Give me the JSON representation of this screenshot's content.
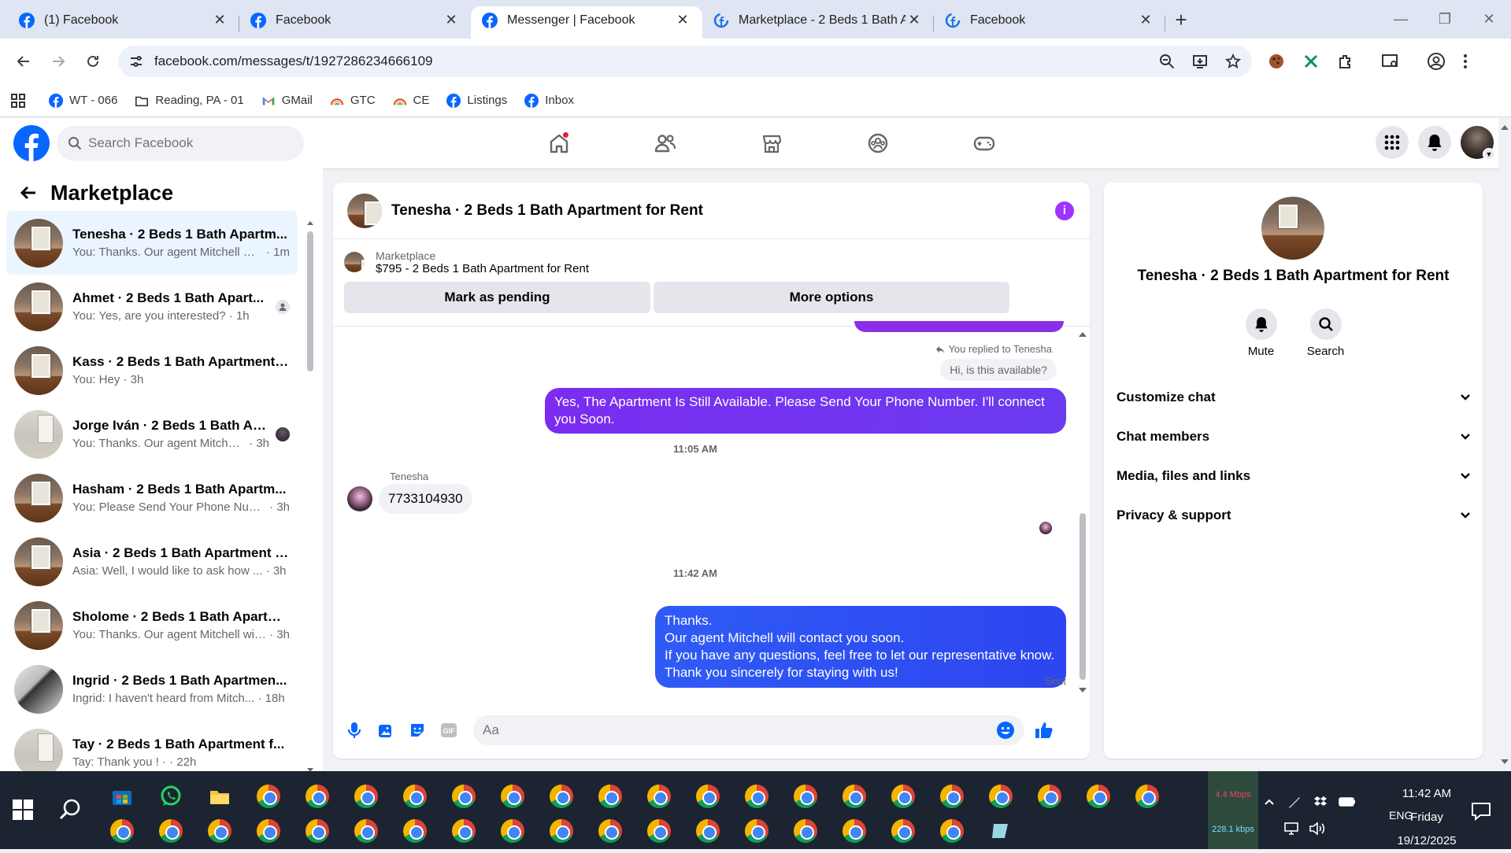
{
  "browser": {
    "tabs": [
      {
        "title": "(1) Facebook",
        "active": false,
        "icon": "facebook-icon"
      },
      {
        "title": "Facebook",
        "active": false,
        "icon": "facebook-icon"
      },
      {
        "title": "Messenger | Facebook",
        "active": true,
        "icon": "facebook-icon"
      },
      {
        "title": "Marketplace - 2 Beds 1 Bath Ap",
        "active": false,
        "icon": "loading-facebook-icon"
      },
      {
        "title": "Facebook",
        "active": false,
        "icon": "loading-facebook-icon"
      }
    ],
    "url": "facebook.com/messages/t/1927286234666109",
    "bookmarks": [
      {
        "label": "WT - 066",
        "icon": "facebook-icon"
      },
      {
        "label": "Reading, PA - 01",
        "icon": "folder-icon"
      },
      {
        "label": "GMail",
        "icon": "gmail-icon"
      },
      {
        "label": "GTC",
        "icon": "rainbow-icon"
      },
      {
        "label": "CE",
        "icon": "rainbow-icon"
      },
      {
        "label": "Listings",
        "icon": "facebook-icon"
      },
      {
        "label": "Inbox",
        "icon": "facebook-icon"
      }
    ]
  },
  "facebook": {
    "search_placeholder": "Search Facebook",
    "brand_color": "#0866ff"
  },
  "left": {
    "title": "Marketplace",
    "chats": [
      {
        "title": "Tenesha · 2 Beds 1 Bath Apartm...",
        "preview": "You: Thanks. Our agent Mitchell wi...",
        "time": "1m",
        "selected": true,
        "thumb": "room",
        "seen": ""
      },
      {
        "title": "Ahmet · 2 Beds 1 Bath Apart...",
        "preview": "You: Yes, are you interested?",
        "time": "1h",
        "selected": false,
        "thumb": "room",
        "seen": "gray"
      },
      {
        "title": "Kass · 2 Beds 1 Bath Apartment ...",
        "preview": "You: Hey",
        "time": "3h",
        "selected": false,
        "thumb": "room",
        "seen": ""
      },
      {
        "title": "Jorge Iván · 2 Beds 1 Bath Apa...",
        "preview": "You: Thanks. Our agent Mitchell ...",
        "time": "3h",
        "selected": false,
        "thumb": "room2",
        "seen": "photo"
      },
      {
        "title": "Hasham · 2 Beds 1 Bath Apartm...",
        "preview": "You: Please Send Your Phone Num...",
        "time": "3h",
        "selected": false,
        "thumb": "room",
        "seen": ""
      },
      {
        "title": "Asia · 2 Beds 1 Bath Apartment f...",
        "preview": "Asia: Well, I would like to ask how ...",
        "time": "3h",
        "selected": false,
        "thumb": "room",
        "seen": ""
      },
      {
        "title": "Sholome · 2 Beds 1 Bath Apartm...",
        "preview": "You: Thanks. Our agent Mitchell wil...",
        "time": "3h",
        "selected": false,
        "thumb": "room",
        "seen": ""
      },
      {
        "title": "Ingrid · 2 Beds 1 Bath Apartmen...",
        "preview": "Ingrid: I haven't heard from Mitch...",
        "time": "18h",
        "selected": false,
        "thumb": "room3",
        "seen": ""
      },
      {
        "title": "Tay · 2 Beds 1 Bath Apartment f...",
        "preview": "Tay: Thank you ! ·",
        "time": "22h",
        "selected": false,
        "thumb": "room2",
        "seen": ""
      }
    ]
  },
  "conversation": {
    "title": "Tenesha · 2 Beds 1 Bath Apartment for Rent",
    "marketplace_label": "Marketplace",
    "listing": "$795 - 2 Beds 1 Bath Apartment for Rent",
    "mark_pending": "Mark as pending",
    "more_options": "More options",
    "replied_to": "You replied to Tenesha",
    "quoted": "Hi, is this available?",
    "reply_bubble": "Yes, The Apartment Is Still Available. Please Send Your Phone Number. I'll connect you Soon.",
    "time1": "11:05 AM",
    "sender_name": "Tenesha",
    "incoming": "7733104930",
    "time2": "11:42 AM",
    "outgoing_lines": [
      "Thanks.",
      "Our agent Mitchell will contact you soon.",
      "If you have any questions, feel free to let our representative know.",
      "Thank you sincerely for staying with us!"
    ],
    "status": "Sent",
    "input_placeholder": "Aa"
  },
  "info": {
    "title": "Tenesha · 2 Beds 1 Bath Apartment for Rent",
    "actions": [
      {
        "label": "Mute",
        "icon": "bell-icon"
      },
      {
        "label": "Search",
        "icon": "search-icon"
      }
    ],
    "sections": [
      "Customize chat",
      "Chat members",
      "Media, files and links",
      "Privacy & support"
    ]
  },
  "taskbar": {
    "net_up": "4.4 Mbps",
    "net_down": "228.1 kbps",
    "language": "ENG",
    "time": "11:42 AM",
    "day": "Friday",
    "date": "19/12/2025"
  }
}
